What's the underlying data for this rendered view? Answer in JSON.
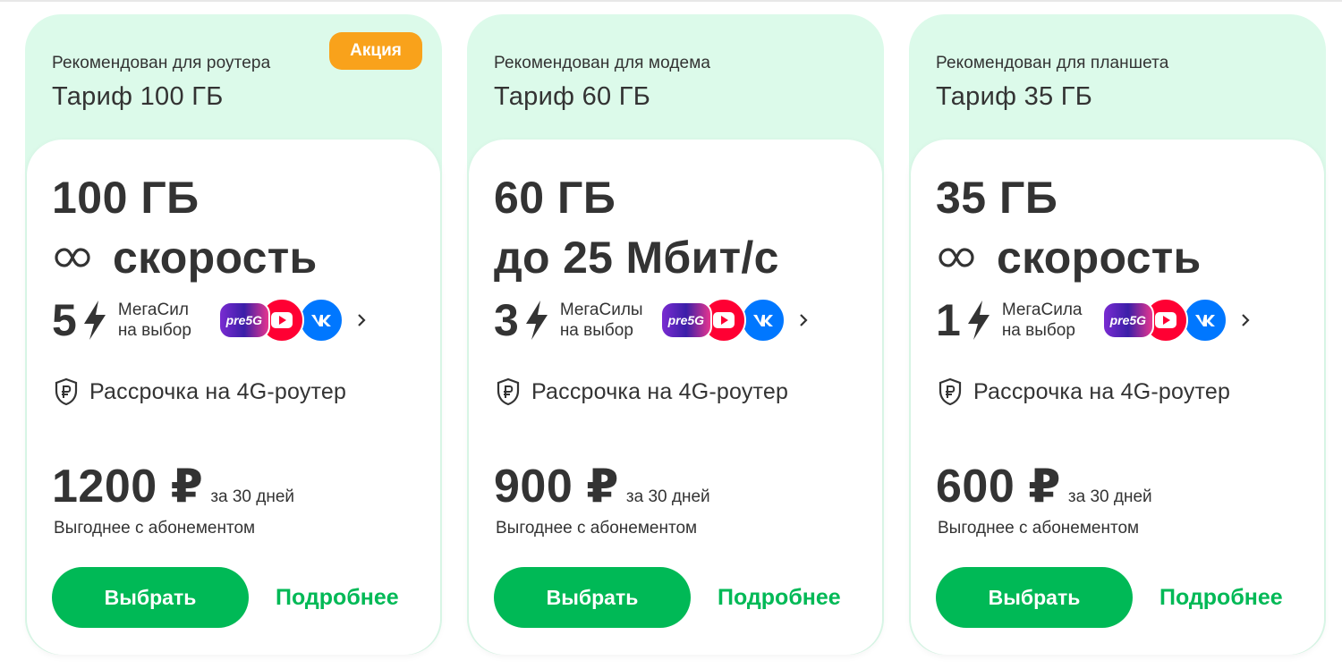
{
  "colors": {
    "accent": "#00b956",
    "card_header": "#dcfaea",
    "badge": "#f9a21b",
    "text": "#333333"
  },
  "cards": [
    {
      "recommended": "Рекомендован для роутера",
      "title": "Тариф 100 ГБ",
      "badge": "Акция",
      "gb": "100 ГБ",
      "speed_icon": "infinity-icon",
      "speed": "скорость",
      "mega_count": "5",
      "mega_line1": "МегаСил",
      "mega_line2": "на выбор",
      "app_pre": "pre5G",
      "installment": "Рассрочка на 4G-роутер",
      "price": "1200 ₽",
      "period": "за 30 дней",
      "note": "Выгоднее с абонементом",
      "select": "Выбрать",
      "more": "Подробнее"
    },
    {
      "recommended": "Рекомендован для модема",
      "title": "Тариф 60 ГБ",
      "badge": "",
      "gb": "60 ГБ",
      "speed_icon": "",
      "speed": "до 25 Мбит/с",
      "mega_count": "3",
      "mega_line1": "МегаСилы",
      "mega_line2": "на выбор",
      "app_pre": "pre5G",
      "installment": "Рассрочка на 4G-роутер",
      "price": "900 ₽",
      "period": "за 30 дней",
      "note": "Выгоднее с абонементом",
      "select": "Выбрать",
      "more": "Подробнее"
    },
    {
      "recommended": "Рекомендован для планшета",
      "title": "Тариф 35 ГБ",
      "badge": "",
      "gb": "35 ГБ",
      "speed_icon": "infinity-icon",
      "speed": "скорость",
      "mega_count": "1",
      "mega_line1": "МегаСила",
      "mega_line2": "на выбор",
      "app_pre": "pre5G",
      "installment": "Рассрочка на 4G-роутер",
      "price": "600 ₽",
      "period": "за 30 дней",
      "note": "Выгоднее с абонементом",
      "select": "Выбрать",
      "more": "Подробнее"
    }
  ]
}
